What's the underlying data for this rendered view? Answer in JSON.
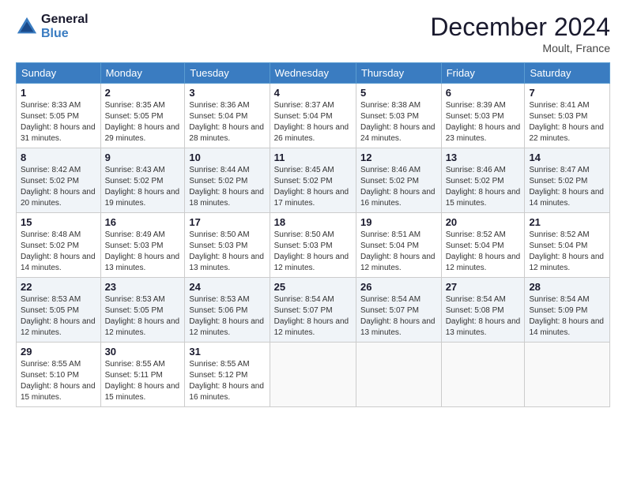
{
  "header": {
    "logo_line1": "General",
    "logo_line2": "Blue",
    "month_title": "December 2024",
    "location": "Moult, France"
  },
  "weekdays": [
    "Sunday",
    "Monday",
    "Tuesday",
    "Wednesday",
    "Thursday",
    "Friday",
    "Saturday"
  ],
  "weeks": [
    [
      {
        "day": "1",
        "sunrise": "8:33 AM",
        "sunset": "5:05 PM",
        "daylight": "8 hours and 31 minutes."
      },
      {
        "day": "2",
        "sunrise": "8:35 AM",
        "sunset": "5:05 PM",
        "daylight": "8 hours and 29 minutes."
      },
      {
        "day": "3",
        "sunrise": "8:36 AM",
        "sunset": "5:04 PM",
        "daylight": "8 hours and 28 minutes."
      },
      {
        "day": "4",
        "sunrise": "8:37 AM",
        "sunset": "5:04 PM",
        "daylight": "8 hours and 26 minutes."
      },
      {
        "day": "5",
        "sunrise": "8:38 AM",
        "sunset": "5:03 PM",
        "daylight": "8 hours and 24 minutes."
      },
      {
        "day": "6",
        "sunrise": "8:39 AM",
        "sunset": "5:03 PM",
        "daylight": "8 hours and 23 minutes."
      },
      {
        "day": "7",
        "sunrise": "8:41 AM",
        "sunset": "5:03 PM",
        "daylight": "8 hours and 22 minutes."
      }
    ],
    [
      {
        "day": "8",
        "sunrise": "8:42 AM",
        "sunset": "5:02 PM",
        "daylight": "8 hours and 20 minutes."
      },
      {
        "day": "9",
        "sunrise": "8:43 AM",
        "sunset": "5:02 PM",
        "daylight": "8 hours and 19 minutes."
      },
      {
        "day": "10",
        "sunrise": "8:44 AM",
        "sunset": "5:02 PM",
        "daylight": "8 hours and 18 minutes."
      },
      {
        "day": "11",
        "sunrise": "8:45 AM",
        "sunset": "5:02 PM",
        "daylight": "8 hours and 17 minutes."
      },
      {
        "day": "12",
        "sunrise": "8:46 AM",
        "sunset": "5:02 PM",
        "daylight": "8 hours and 16 minutes."
      },
      {
        "day": "13",
        "sunrise": "8:46 AM",
        "sunset": "5:02 PM",
        "daylight": "8 hours and 15 minutes."
      },
      {
        "day": "14",
        "sunrise": "8:47 AM",
        "sunset": "5:02 PM",
        "daylight": "8 hours and 14 minutes."
      }
    ],
    [
      {
        "day": "15",
        "sunrise": "8:48 AM",
        "sunset": "5:02 PM",
        "daylight": "8 hours and 14 minutes."
      },
      {
        "day": "16",
        "sunrise": "8:49 AM",
        "sunset": "5:03 PM",
        "daylight": "8 hours and 13 minutes."
      },
      {
        "day": "17",
        "sunrise": "8:50 AM",
        "sunset": "5:03 PM",
        "daylight": "8 hours and 13 minutes."
      },
      {
        "day": "18",
        "sunrise": "8:50 AM",
        "sunset": "5:03 PM",
        "daylight": "8 hours and 12 minutes."
      },
      {
        "day": "19",
        "sunrise": "8:51 AM",
        "sunset": "5:04 PM",
        "daylight": "8 hours and 12 minutes."
      },
      {
        "day": "20",
        "sunrise": "8:52 AM",
        "sunset": "5:04 PM",
        "daylight": "8 hours and 12 minutes."
      },
      {
        "day": "21",
        "sunrise": "8:52 AM",
        "sunset": "5:04 PM",
        "daylight": "8 hours and 12 minutes."
      }
    ],
    [
      {
        "day": "22",
        "sunrise": "8:53 AM",
        "sunset": "5:05 PM",
        "daylight": "8 hours and 12 minutes."
      },
      {
        "day": "23",
        "sunrise": "8:53 AM",
        "sunset": "5:05 PM",
        "daylight": "8 hours and 12 minutes."
      },
      {
        "day": "24",
        "sunrise": "8:53 AM",
        "sunset": "5:06 PM",
        "daylight": "8 hours and 12 minutes."
      },
      {
        "day": "25",
        "sunrise": "8:54 AM",
        "sunset": "5:07 PM",
        "daylight": "8 hours and 12 minutes."
      },
      {
        "day": "26",
        "sunrise": "8:54 AM",
        "sunset": "5:07 PM",
        "daylight": "8 hours and 13 minutes."
      },
      {
        "day": "27",
        "sunrise": "8:54 AM",
        "sunset": "5:08 PM",
        "daylight": "8 hours and 13 minutes."
      },
      {
        "day": "28",
        "sunrise": "8:54 AM",
        "sunset": "5:09 PM",
        "daylight": "8 hours and 14 minutes."
      }
    ],
    [
      {
        "day": "29",
        "sunrise": "8:55 AM",
        "sunset": "5:10 PM",
        "daylight": "8 hours and 15 minutes."
      },
      {
        "day": "30",
        "sunrise": "8:55 AM",
        "sunset": "5:11 PM",
        "daylight": "8 hours and 15 minutes."
      },
      {
        "day": "31",
        "sunrise": "8:55 AM",
        "sunset": "5:12 PM",
        "daylight": "8 hours and 16 minutes."
      },
      null,
      null,
      null,
      null
    ]
  ]
}
